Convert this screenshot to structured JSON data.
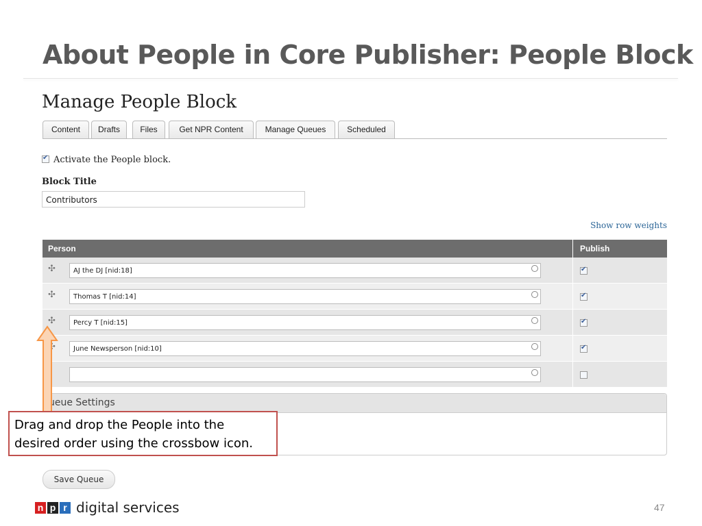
{
  "slide": {
    "title": "About People in Core Publisher: People Block",
    "page_number": "47"
  },
  "page": {
    "heading": "Manage People Block",
    "tabs": [
      {
        "label": "Content"
      },
      {
        "label": "Drafts"
      },
      {
        "label": "Files"
      },
      {
        "label": "Get NPR Content"
      },
      {
        "label": "Manage Queues"
      },
      {
        "label": "Scheduled"
      }
    ],
    "activate_label": "Activate the People block.",
    "activate_checked": true,
    "block_title_label": "Block Title",
    "block_title_value": "Contributors",
    "show_row_weights": "Show row weights"
  },
  "table": {
    "headers": {
      "person": "Person",
      "publish": "Publish"
    },
    "rows": [
      {
        "person": "AJ the DJ [nid:18]",
        "publish": true
      },
      {
        "person": "Thomas T [nid:14]",
        "publish": true
      },
      {
        "person": "Percy T [nid:15]",
        "publish": true
      },
      {
        "person": "June Newsperson [nid:10]",
        "publish": true
      },
      {
        "person": "",
        "publish": false
      }
    ]
  },
  "queue_settings": {
    "header": "ueue Settings"
  },
  "save_button": "Save Queue",
  "callout": {
    "text": "Drag and drop the People into the desired order using the crossbow icon."
  },
  "footer": {
    "logo_letters": [
      "n",
      "p",
      "r"
    ],
    "brand_text": "digital services"
  },
  "colors": {
    "npr_red": "#d62021",
    "npr_black": "#222222",
    "npr_blue": "#2a6ebb",
    "callout_border": "#c0504d",
    "arrow_fill": "#fbd5b5",
    "arrow_stroke": "#f79646"
  }
}
